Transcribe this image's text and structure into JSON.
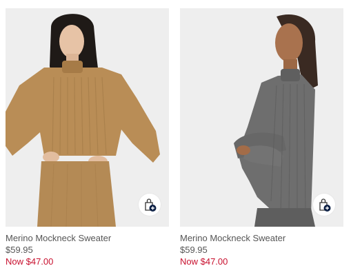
{
  "products": [
    {
      "title": "Merino Mockneck Sweater",
      "price": "$59.95",
      "sale_price": "Now $47.00",
      "sweater_color": "#b98d56",
      "skirt_color": "#b48a55",
      "quick_add_icon": "shopping-bag-plus-icon"
    },
    {
      "title": "Merino Mockneck Sweater",
      "price": "$59.95",
      "sale_price": "Now $47.00",
      "sweater_color": "#6e6e6e",
      "skirt_color": "#5e5e5e",
      "quick_add_icon": "shopping-bag-plus-icon"
    }
  ],
  "colors": {
    "photo_bg": "#eeeeee",
    "text": "#555555",
    "sale": "#c8102e",
    "icon_dark": "#0b1f44"
  }
}
